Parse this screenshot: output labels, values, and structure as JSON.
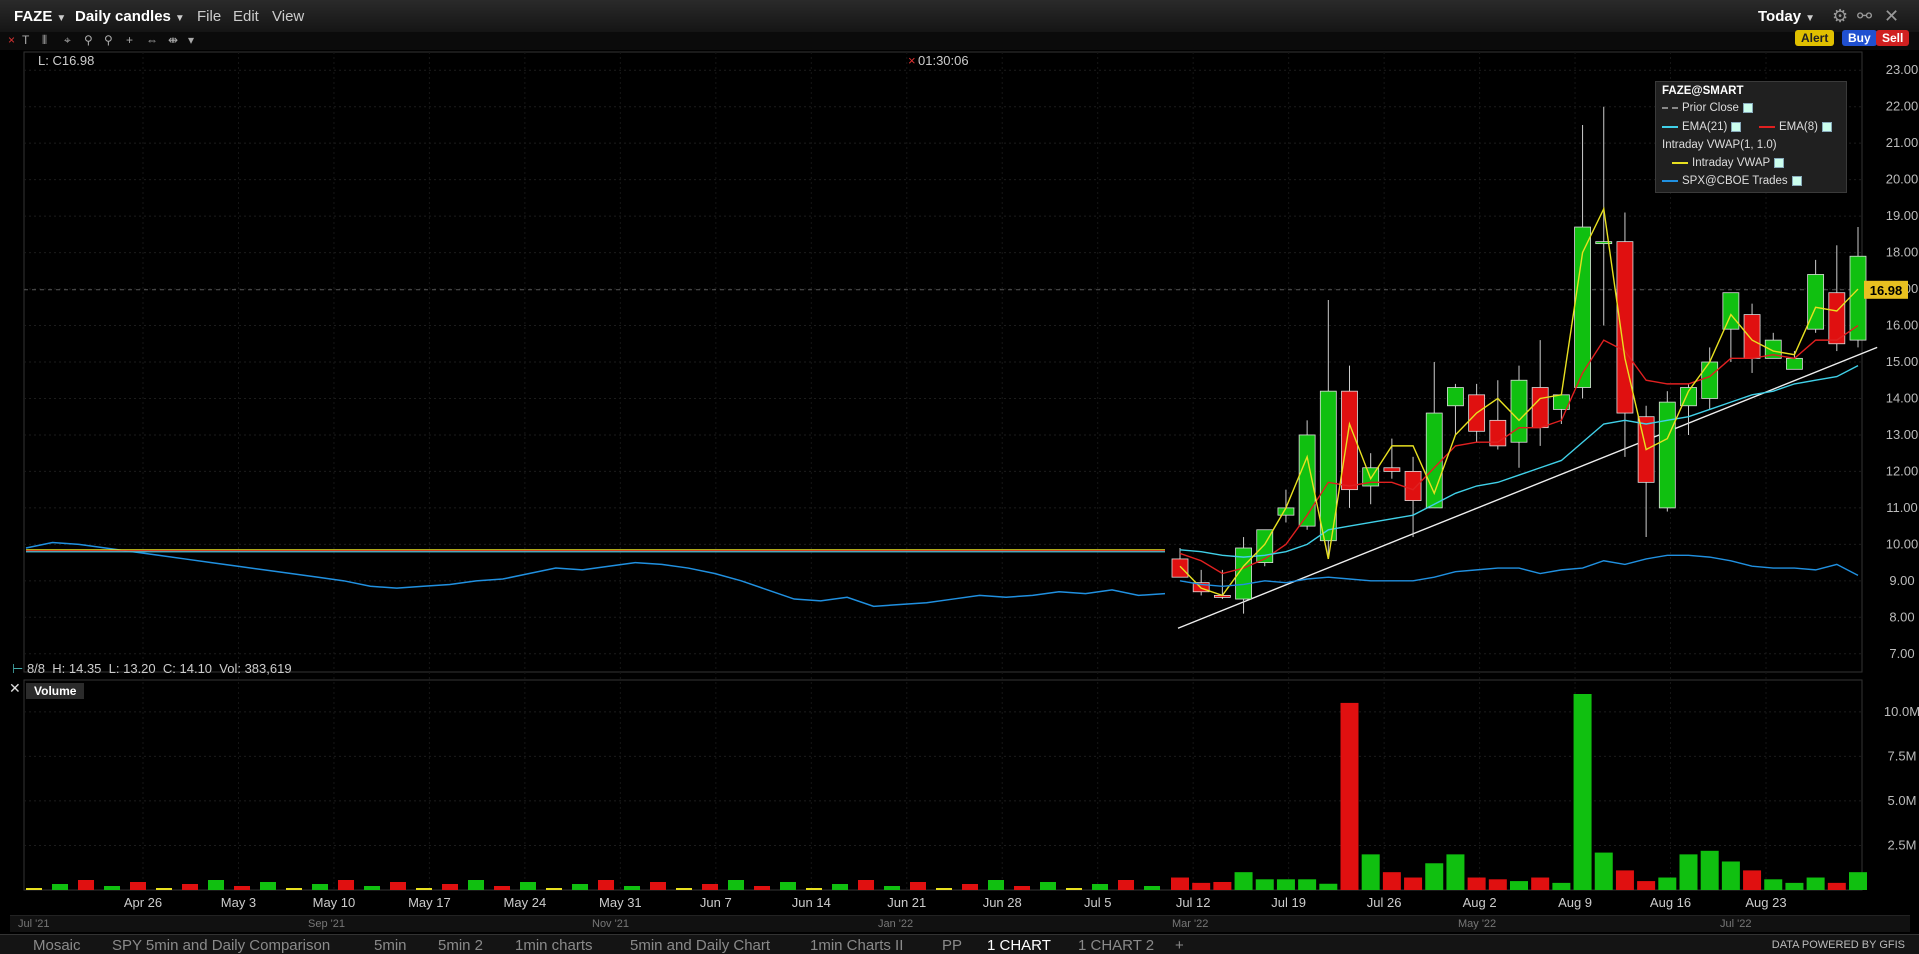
{
  "toolbar": {
    "symbol": "FAZE",
    "timeframe": "Daily candles",
    "menus": [
      "File",
      "Edit",
      "View"
    ],
    "period": "Today",
    "buttons": {
      "alert": "Alert",
      "buy": "Buy",
      "sell": "Sell"
    }
  },
  "price_pane": {
    "last_label": "L: C16.98",
    "crosshair_time": "01:30:06",
    "bar_info": {
      "date": "8/8",
      "high": "H: 14.35",
      "low": "L: 13.20",
      "close": "C: 14.10",
      "volume": "Vol: 383,619"
    },
    "current_price_tag": "16.98"
  },
  "legend": {
    "title": "FAZE@SMART",
    "items": [
      {
        "label": "Prior Close",
        "color": "#888888"
      },
      {
        "label": "EMA(21)",
        "color": "#40d0e8"
      },
      {
        "label": "EMA(8)",
        "color": "#e02020"
      },
      {
        "label": "Intraday VWAP(1, 1.0)",
        "color": ""
      },
      {
        "label": "Intraday VWAP",
        "color": "#e8e020"
      },
      {
        "label": "SPX@CBOE Trades",
        "color": "#2090e0"
      }
    ]
  },
  "volume_pane": {
    "title": "Volume"
  },
  "scroller_labels": [
    "Jul '21",
    "Sep '21",
    "Nov '21",
    "Jan '22",
    "Mar '22",
    "May '22",
    "Jul '22"
  ],
  "bottom_tabs": [
    "Mosaic",
    "SPY 5min and Daily Comparison",
    "5min",
    "5min 2",
    "1min charts",
    "5min and Daily Chart",
    "1min Charts II",
    "PP",
    "1 CHART",
    "1 CHART 2",
    "+"
  ],
  "active_tab": "1 CHART",
  "powered_by": "DATA POWERED BY GFIS",
  "chart_data": {
    "type": "candlestick",
    "y_ticks": [
      "23.00",
      "22.00",
      "21.00",
      "20.00",
      "19.00",
      "18.00",
      "17.00",
      "16.00",
      "15.00",
      "14.00",
      "13.00",
      "12.00",
      "11.00",
      "10.00",
      "9.00",
      "8.00",
      "7.00"
    ],
    "ylim": [
      6.5,
      23.5
    ],
    "volume_ticks": [
      "10.0M",
      "7.5M",
      "5.0M",
      "2.5M"
    ],
    "volume_ylim": [
      0,
      11000000
    ],
    "x_tick_labels": [
      "Apr 26",
      "May 3",
      "May 10",
      "May 17",
      "May 24",
      "May 31",
      "Jun 7",
      "Jun 14",
      "Jun 21",
      "Jun 28",
      "Jul 5",
      "Jul 12",
      "Jul 19",
      "Jul 26",
      "Aug 2",
      "Aug 9",
      "Aug 16",
      "Aug 23"
    ],
    "series": [
      {
        "name": "FAZE",
        "candles": [
          {
            "o": 9.6,
            "h": 9.9,
            "l": 9.2,
            "c": 9.1
          },
          {
            "o": 8.95,
            "h": 9.3,
            "l": 8.6,
            "c": 8.7
          },
          {
            "o": 8.6,
            "h": 9.3,
            "l": 8.5,
            "c": 8.55
          },
          {
            "o": 8.5,
            "h": 10.2,
            "l": 8.1,
            "c": 9.9
          },
          {
            "o": 9.5,
            "h": 10.4,
            "l": 9.4,
            "c": 10.4
          },
          {
            "o": 10.8,
            "h": 11.5,
            "l": 10.6,
            "c": 11.0
          },
          {
            "o": 10.5,
            "h": 13.4,
            "l": 10.4,
            "c": 13.0
          },
          {
            "o": 10.1,
            "h": 16.7,
            "l": 9.6,
            "c": 14.2
          },
          {
            "o": 14.2,
            "h": 14.9,
            "l": 11.0,
            "c": 11.5
          },
          {
            "o": 11.6,
            "h": 12.5,
            "l": 11.1,
            "c": 12.1
          },
          {
            "o": 12.1,
            "h": 12.9,
            "l": 11.8,
            "c": 12.0
          },
          {
            "o": 12.0,
            "h": 12.4,
            "l": 10.2,
            "c": 11.2
          },
          {
            "o": 11.0,
            "h": 15.0,
            "l": 11.0,
            "c": 13.6
          },
          {
            "o": 13.8,
            "h": 14.4,
            "l": 13.0,
            "c": 14.3
          },
          {
            "o": 14.1,
            "h": 14.4,
            "l": 12.8,
            "c": 13.1
          },
          {
            "o": 13.4,
            "h": 14.5,
            "l": 12.6,
            "c": 12.7
          },
          {
            "o": 12.8,
            "h": 14.9,
            "l": 12.1,
            "c": 14.5
          },
          {
            "o": 14.3,
            "h": 15.6,
            "l": 12.7,
            "c": 13.2
          },
          {
            "o": 13.7,
            "h": 14.1,
            "l": 13.3,
            "c": 14.1
          },
          {
            "o": 14.3,
            "h": 21.5,
            "l": 14.0,
            "c": 18.7
          },
          {
            "o": 18.3,
            "h": 22.0,
            "l": 16.0,
            "c": 18.3
          },
          {
            "o": 18.3,
            "h": 19.1,
            "l": 12.4,
            "c": 13.6
          },
          {
            "o": 13.5,
            "h": 13.8,
            "l": 10.2,
            "c": 11.7
          },
          {
            "o": 11.0,
            "h": 14.2,
            "l": 10.9,
            "c": 13.9
          },
          {
            "o": 13.8,
            "h": 14.4,
            "l": 13.0,
            "c": 14.3
          },
          {
            "o": 14.0,
            "h": 15.4,
            "l": 13.7,
            "c": 15.0
          },
          {
            "o": 15.9,
            "h": 16.8,
            "l": 15.0,
            "c": 16.9
          },
          {
            "o": 16.3,
            "h": 16.6,
            "l": 14.7,
            "c": 15.1
          },
          {
            "o": 15.1,
            "h": 15.8,
            "l": 15.1,
            "c": 15.6
          },
          {
            "o": 14.8,
            "h": 15.3,
            "l": 14.8,
            "c": 15.1
          },
          {
            "o": 15.9,
            "h": 17.8,
            "l": 15.8,
            "c": 17.4
          },
          {
            "o": 16.9,
            "h": 18.2,
            "l": 15.3,
            "c": 15.5
          },
          {
            "o": 15.6,
            "h": 18.7,
            "l": 15.4,
            "c": 17.9
          }
        ]
      },
      {
        "name": "Volume",
        "values": [
          700000,
          400000,
          450000,
          1000000,
          600000,
          600000,
          600000,
          350000,
          10500000,
          2000000,
          1000000,
          700000,
          1500000,
          2000000,
          700000,
          600000,
          500000,
          700000,
          400000,
          11000000,
          2100000,
          1100000,
          500000,
          700000,
          2000000,
          2200000,
          1600000,
          1100000,
          600000,
          400000,
          700000,
          400000,
          1000000
        ]
      },
      {
        "name": "EMA(8)",
        "values": [
          9.75,
          9.55,
          9.2,
          9.35,
          9.6,
          10.0,
          10.8,
          11.7,
          11.6,
          11.7,
          11.7,
          11.5,
          12.1,
          12.7,
          12.8,
          12.8,
          13.2,
          13.2,
          13.4,
          14.7,
          15.6,
          15.3,
          14.5,
          14.4,
          14.4,
          14.6,
          15.1,
          15.1,
          15.2,
          15.1,
          15.6,
          15.6,
          16.0
        ]
      },
      {
        "name": "EMA(21)",
        "values": [
          9.85,
          9.8,
          9.7,
          9.65,
          9.7,
          9.8,
          10.0,
          10.4,
          10.5,
          10.6,
          10.7,
          10.8,
          11.1,
          11.4,
          11.6,
          11.7,
          11.9,
          12.1,
          12.3,
          12.8,
          13.3,
          13.4,
          13.3,
          13.4,
          13.5,
          13.7,
          13.9,
          14.1,
          14.2,
          14.4,
          14.5,
          14.6,
          14.9
        ]
      },
      {
        "name": "Intraday VWAP",
        "values": [
          9.4,
          8.8,
          8.6,
          9.4,
          10.0,
          11.0,
          12.4,
          9.6,
          13.3,
          11.8,
          12.7,
          12.7,
          11.4,
          13.0,
          13.6,
          14.0,
          13.4,
          14.0,
          14.1,
          18.0,
          19.2,
          15.1,
          12.6,
          12.9,
          14.2,
          15.0,
          16.3,
          15.6,
          15.3,
          15.2,
          16.5,
          16.4,
          17.0
        ]
      },
      {
        "name": "SPX@CBOE Trades",
        "values": [
          9.0,
          8.9,
          8.85,
          8.9,
          9.0,
          8.95,
          9.05,
          9.1,
          9.05,
          9.0,
          9.0,
          9.0,
          9.1,
          9.25,
          9.3,
          9.35,
          9.35,
          9.2,
          9.3,
          9.35,
          9.55,
          9.45,
          9.6,
          9.7,
          9.7,
          9.65,
          9.55,
          9.4,
          9.35,
          9.35,
          9.3,
          9.45,
          9.15
        ]
      }
    ],
    "flat_history": {
      "price": 9.85,
      "spx_path": [
        9.9,
        10.05,
        10.0,
        9.9,
        9.8,
        9.7,
        9.6,
        9.5,
        9.4,
        9.3,
        9.2,
        9.1,
        9.0,
        8.85,
        8.8,
        8.85,
        8.9,
        9.0,
        9.05,
        9.2,
        9.35,
        9.3,
        9.4,
        9.5,
        9.45,
        9.35,
        9.2,
        9.0,
        8.75,
        8.5,
        8.45,
        8.55,
        8.3,
        8.35,
        8.4,
        8.5,
        8.6,
        8.55,
        8.6,
        8.7,
        8.65,
        8.75,
        8.6,
        8.65
      ]
    },
    "trendline": {
      "from": [
        0,
        7.7
      ],
      "to": [
        33,
        15.4
      ]
    }
  }
}
